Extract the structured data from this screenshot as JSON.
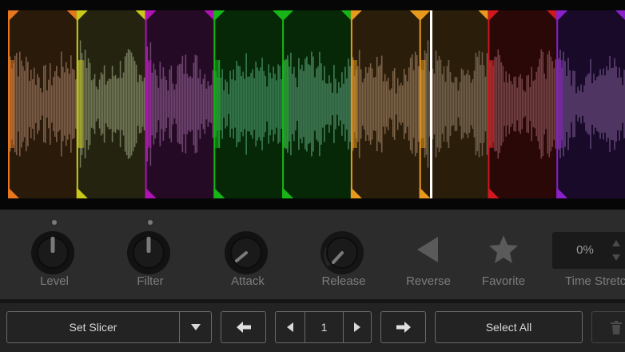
{
  "waveform": {
    "background": "#060606",
    "playhead_color": "#ffffff",
    "slices": [
      {
        "color": "#e8761d",
        "fill": "#2a1a0a",
        "wave": "#8a6a52"
      },
      {
        "color": "#c9c91a",
        "fill": "#232310",
        "wave": "#7c8462"
      },
      {
        "color": "#b012b4",
        "fill": "#240a24",
        "wave": "#7a4e7c"
      },
      {
        "color": "#17b517",
        "fill": "#062806",
        "wave": "#3f8a5e"
      },
      {
        "color": "#17b517",
        "fill": "#062806",
        "wave": "#4c8a66"
      },
      {
        "color": "#e89a1d",
        "fill": "#2a1d0a",
        "wave": "#8a6e52"
      },
      {
        "color": "#e89a1d",
        "fill": "#2a1d0a",
        "wave": "#7a6a55"
      },
      {
        "color": "#d0181e",
        "fill": "#2a0808",
        "wave": "#7e4a4e"
      },
      {
        "color": "#8a20c8",
        "fill": "#180a28",
        "wave": "#6a4a7e"
      }
    ]
  },
  "controls": {
    "level": {
      "label": "Level",
      "value": 0.5
    },
    "filter": {
      "label": "Filter",
      "value": 0.5
    },
    "attack": {
      "label": "Attack",
      "value": 0.0
    },
    "release": {
      "label": "Release",
      "value": 0.2
    },
    "reverse": {
      "label": "Reverse",
      "icon": "reverse-triangle-icon"
    },
    "favorite": {
      "label": "Favorite",
      "icon": "star-icon"
    },
    "time_stretch": {
      "label": "Time Stretch",
      "value": "0%"
    }
  },
  "toolbar": {
    "slicer_mode": "Set Slicer",
    "page_value": "1",
    "select_all": "Select All",
    "icons": [
      "chevron-down-icon",
      "arrow-left-icon",
      "caret-left-icon",
      "caret-right-icon",
      "arrow-right-icon",
      "trash-icon"
    ]
  },
  "colors": {
    "panel": "#2c2c2c",
    "toolbar": "#232323",
    "label": "#7d7d7d",
    "button_border": "#6a6a6a"
  }
}
